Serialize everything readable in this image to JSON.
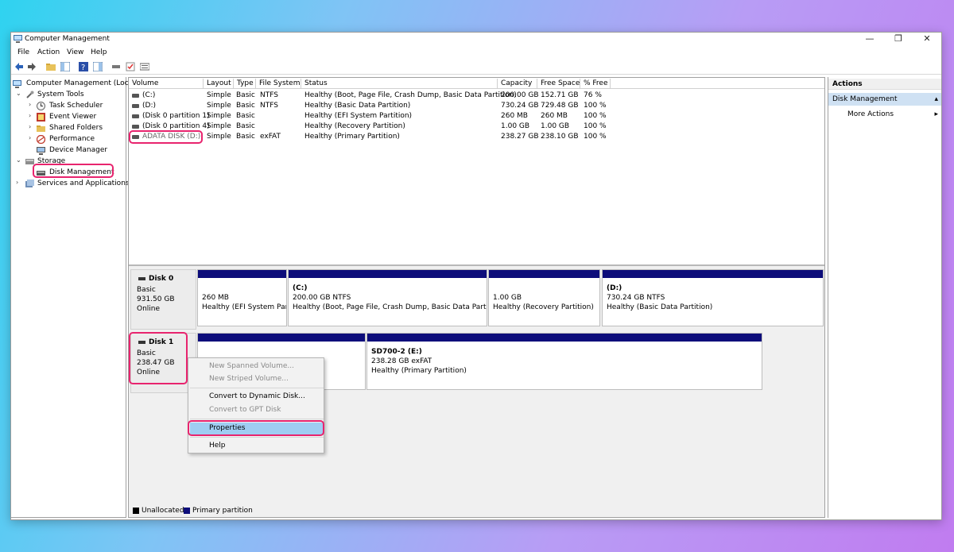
{
  "window": {
    "title": "Computer Management",
    "minimize": "—",
    "maximize": "❐",
    "close": "✕"
  },
  "menu": [
    "File",
    "Action",
    "View",
    "Help"
  ],
  "tree": {
    "root": "Computer Management (Local)",
    "system_tools": "System Tools",
    "task_scheduler": "Task Scheduler",
    "event_viewer": "Event Viewer",
    "shared_folders": "Shared Folders",
    "performance": "Performance",
    "device_manager": "Device Manager",
    "storage": "Storage",
    "disk_management": "Disk Management",
    "services": "Services and Applications"
  },
  "volumes": {
    "columns": [
      "Volume",
      "Layout",
      "Type",
      "File System",
      "Status",
      "Capacity",
      "Free Space",
      "% Free"
    ],
    "rows": [
      [
        "(C:)",
        "Simple",
        "Basic",
        "NTFS",
        "Healthy (Boot, Page File, Crash Dump, Basic Data Partition)",
        "200.00 GB",
        "152.71 GB",
        "76 %"
      ],
      [
        "(D:)",
        "Simple",
        "Basic",
        "NTFS",
        "Healthy (Basic Data Partition)",
        "730.24 GB",
        "729.48 GB",
        "100 %"
      ],
      [
        "(Disk 0 partition 1)",
        "Simple",
        "Basic",
        "",
        "Healthy (EFI System Partition)",
        "260 MB",
        "260 MB",
        "100 %"
      ],
      [
        "(Disk 0 partition 4)",
        "Simple",
        "Basic",
        "",
        "Healthy (Recovery Partition)",
        "1.00 GB",
        "1.00 GB",
        "100 %"
      ],
      [
        "ADATA DISK (D:)",
        "Simple",
        "Basic",
        "exFAT",
        "Healthy (Primary Partition)",
        "238.27 GB",
        "238.10 GB",
        "100 %"
      ]
    ]
  },
  "disk0": {
    "name": "Disk 0",
    "type": "Basic",
    "size": "931.50 GB",
    "state": "Online",
    "partitions": [
      {
        "label": "",
        "size": "260 MB",
        "status": "Healthy (EFI System Partit"
      },
      {
        "label": "(C:)",
        "size": "200.00 GB NTFS",
        "status": "Healthy (Boot, Page File, Crash Dump, Basic Data Partition)"
      },
      {
        "label": "",
        "size": "1.00 GB",
        "status": "Healthy (Recovery Partition)"
      },
      {
        "label": "(D:)",
        "size": "730.24 GB NTFS",
        "status": "Healthy (Basic Data Partition)"
      }
    ]
  },
  "disk1": {
    "name": "Disk 1",
    "type": "Basic",
    "size": "238.47 GB",
    "state": "Online",
    "partitions": [
      {
        "label": "SD700-2  (E:)",
        "size": "238.28 GB exFAT",
        "status": "Healthy (Primary Partition)"
      }
    ]
  },
  "context_menu": {
    "spanned": "New Spanned Volume...",
    "striped": "New Striped Volume...",
    "convert_dynamic": "Convert to Dynamic Disk...",
    "convert_gpt": "Convert to GPT Disk",
    "properties": "Properties",
    "help": "Help"
  },
  "legend": {
    "unallocated": "Unallocated",
    "primary": "Primary partition"
  },
  "actions": {
    "header": "Actions",
    "selected": "Disk Management",
    "more": "More Actions"
  },
  "colors": {
    "partition_bar": "#0d0d7a",
    "highlight": "#e8246e",
    "menu_highlight": "#9fcdf2"
  }
}
